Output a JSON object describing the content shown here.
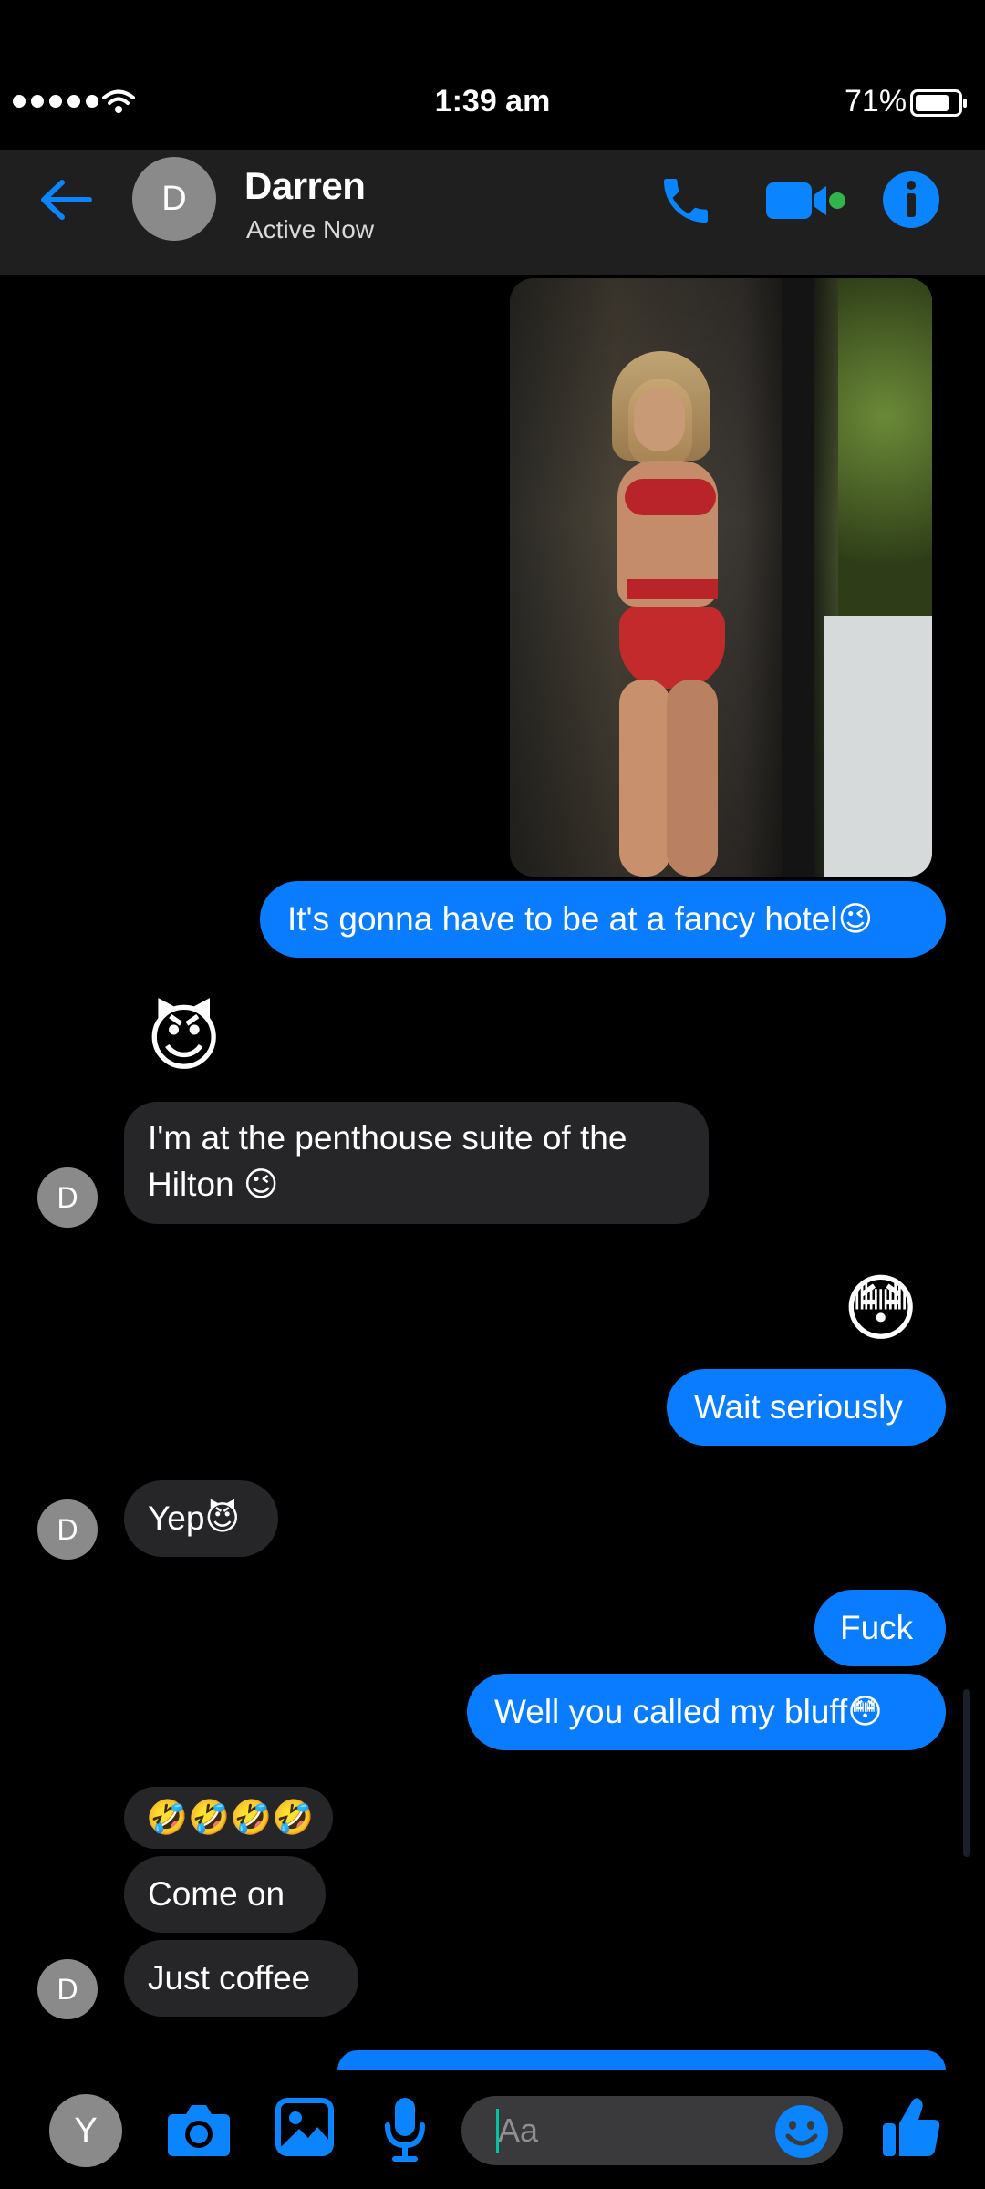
{
  "status_bar": {
    "time": "1:39 am",
    "battery": "71%"
  },
  "header": {
    "avatar_letter": "D",
    "name": "Darren",
    "status": "Active Now"
  },
  "messages": [
    {
      "from": "me",
      "type": "image",
      "description": "photo"
    },
    {
      "from": "me",
      "text": "It's gonna have to be at a fancy hotel😉"
    },
    {
      "from": "them",
      "text": "😈"
    },
    {
      "from": "them",
      "text_line1": "I'm at the penthouse suite of the",
      "text_line2": "Hilton 😉"
    },
    {
      "from": "me",
      "text": "😳"
    },
    {
      "from": "me",
      "text": "Wait seriously"
    },
    {
      "from": "them",
      "text": "Yep😈"
    },
    {
      "from": "me",
      "text": "Fuck"
    },
    {
      "from": "me",
      "text": "Well you called my bluff😳"
    },
    {
      "from": "them",
      "text": "🤣🤣🤣🤣"
    },
    {
      "from": "them",
      "text": "Come on"
    },
    {
      "from": "them",
      "text": "Just coffee"
    }
  ],
  "composer": {
    "placeholder": "Aa",
    "user_avatar_letter": "Y"
  },
  "colors": {
    "accent": "#0a7cff",
    "incoming_bubble": "#262628",
    "online": "#31b44c"
  },
  "icons": [
    "back-arrow-icon",
    "phone-icon",
    "video-icon",
    "info-icon",
    "camera-icon",
    "gallery-icon",
    "microphone-icon",
    "emoji-icon",
    "thumbs-up-icon",
    "wifi-icon",
    "battery-icon"
  ]
}
